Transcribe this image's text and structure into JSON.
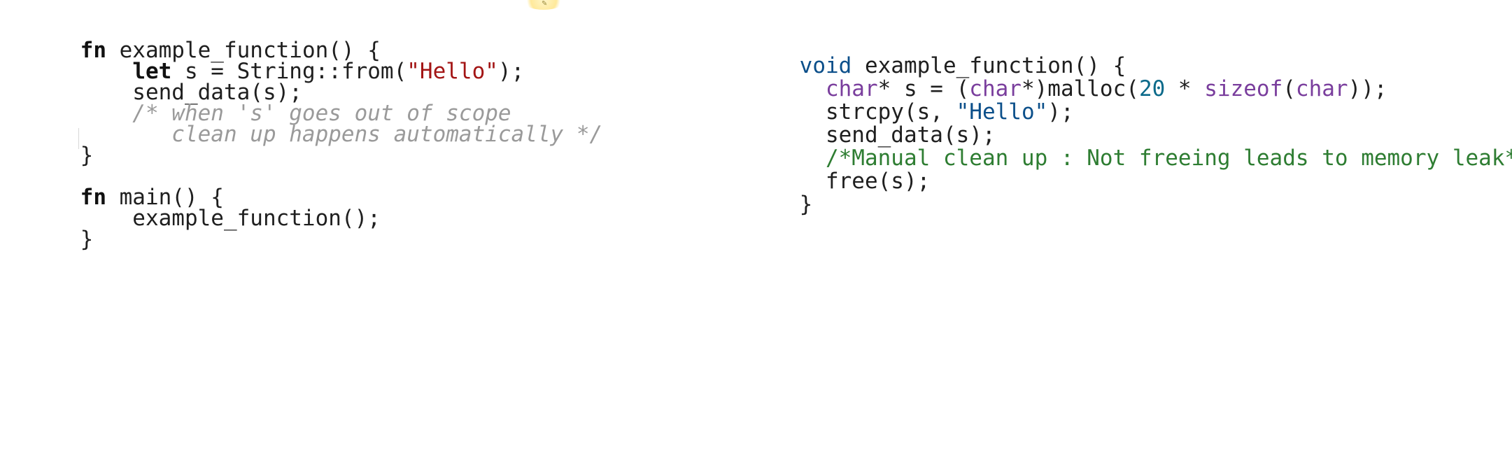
{
  "rust": {
    "l1": {
      "kw": "fn",
      "rest": " example_function() {"
    },
    "l2": {
      "indent": "    ",
      "kw": "let",
      "a": " s = String::from(",
      "str": "\"Hello\"",
      "b": ");"
    },
    "l3": {
      "text": "    send_data(s);"
    },
    "l4": {
      "text": "    /* when 's' goes out of scope"
    },
    "l5": {
      "text": "       clean up happens automatically */"
    },
    "l6": {
      "text": "}"
    },
    "l7": {
      "kw": "fn",
      "rest": " main() {"
    },
    "l8": {
      "text": "    example_function();"
    },
    "l9": {
      "text": "}"
    }
  },
  "c": {
    "l1": {
      "kw": "void",
      "rest": " example_function() {"
    },
    "l2": {
      "i": "  ",
      "t1": "char",
      "a": "* s = (",
      "t2": "char",
      "b": "*)malloc(",
      "num": "20",
      "c": " * ",
      "fn": "sizeof",
      "d": "(",
      "t3": "char",
      "e": "));"
    },
    "l3": {
      "a": "  strcpy(s, ",
      "str": "\"Hello\"",
      "b": ");"
    },
    "l4": {
      "text": "  send_data(s);"
    },
    "l5": {
      "text": "  /*Manual clean up : Not freeing leads to memory leak*/"
    },
    "l6": {
      "text": "  free(s);"
    },
    "l7": {
      "text": "}"
    }
  },
  "colors": {
    "comment_gray": "#9a9a9a",
    "comment_green": "#2e7d32",
    "string_red": "#a31515",
    "c_keyword": "#0b4f8a",
    "c_type": "#7a3e9d"
  }
}
